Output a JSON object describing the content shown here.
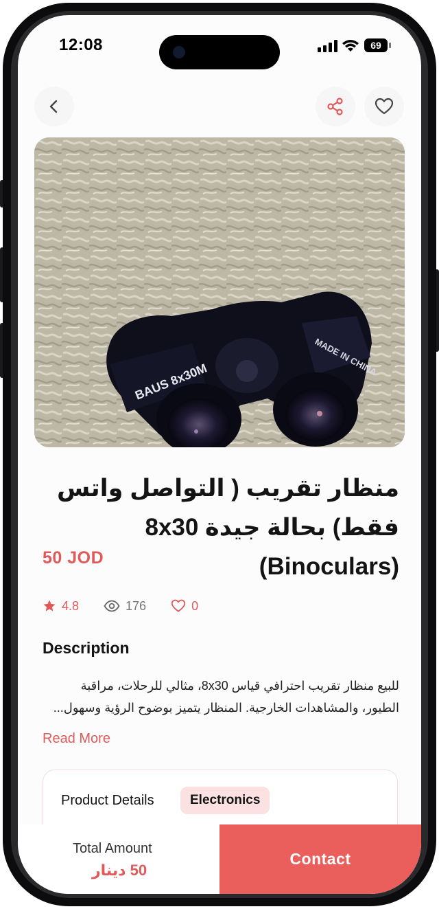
{
  "status_bar": {
    "time": "12:08",
    "battery": "69"
  },
  "nav": {
    "back_icon": "chevron-left-icon",
    "share_icon": "share-icon",
    "favorite_icon": "heart-outline-icon"
  },
  "listing": {
    "image_alt": "binoculars-photo",
    "title": "منظار تقريب ( التواصل واتس فقط) بحالة جيدة 8x30 (Binoculars)",
    "price": "50 JOD",
    "rating": "4.8",
    "views": "176",
    "favorites": "0"
  },
  "description": {
    "heading": "Description",
    "text": "للبيع منظار تقريب احترافي قياس 8x30، مثالي للرحلات، مراقبة الطيور، والمشاهدات الخارجية. المنظار يتميز بوضوح الرؤية وسهول...",
    "read_more": "Read More"
  },
  "details": {
    "label": "Product Details",
    "category": "Electronics"
  },
  "footer": {
    "total_label": "Total Amount",
    "total_value": "50 دينار",
    "contact_label": "Contact"
  },
  "colors": {
    "accent": "#e05a5a",
    "button": "#ea5e5c",
    "tag_bg": "#fbe1e1"
  }
}
